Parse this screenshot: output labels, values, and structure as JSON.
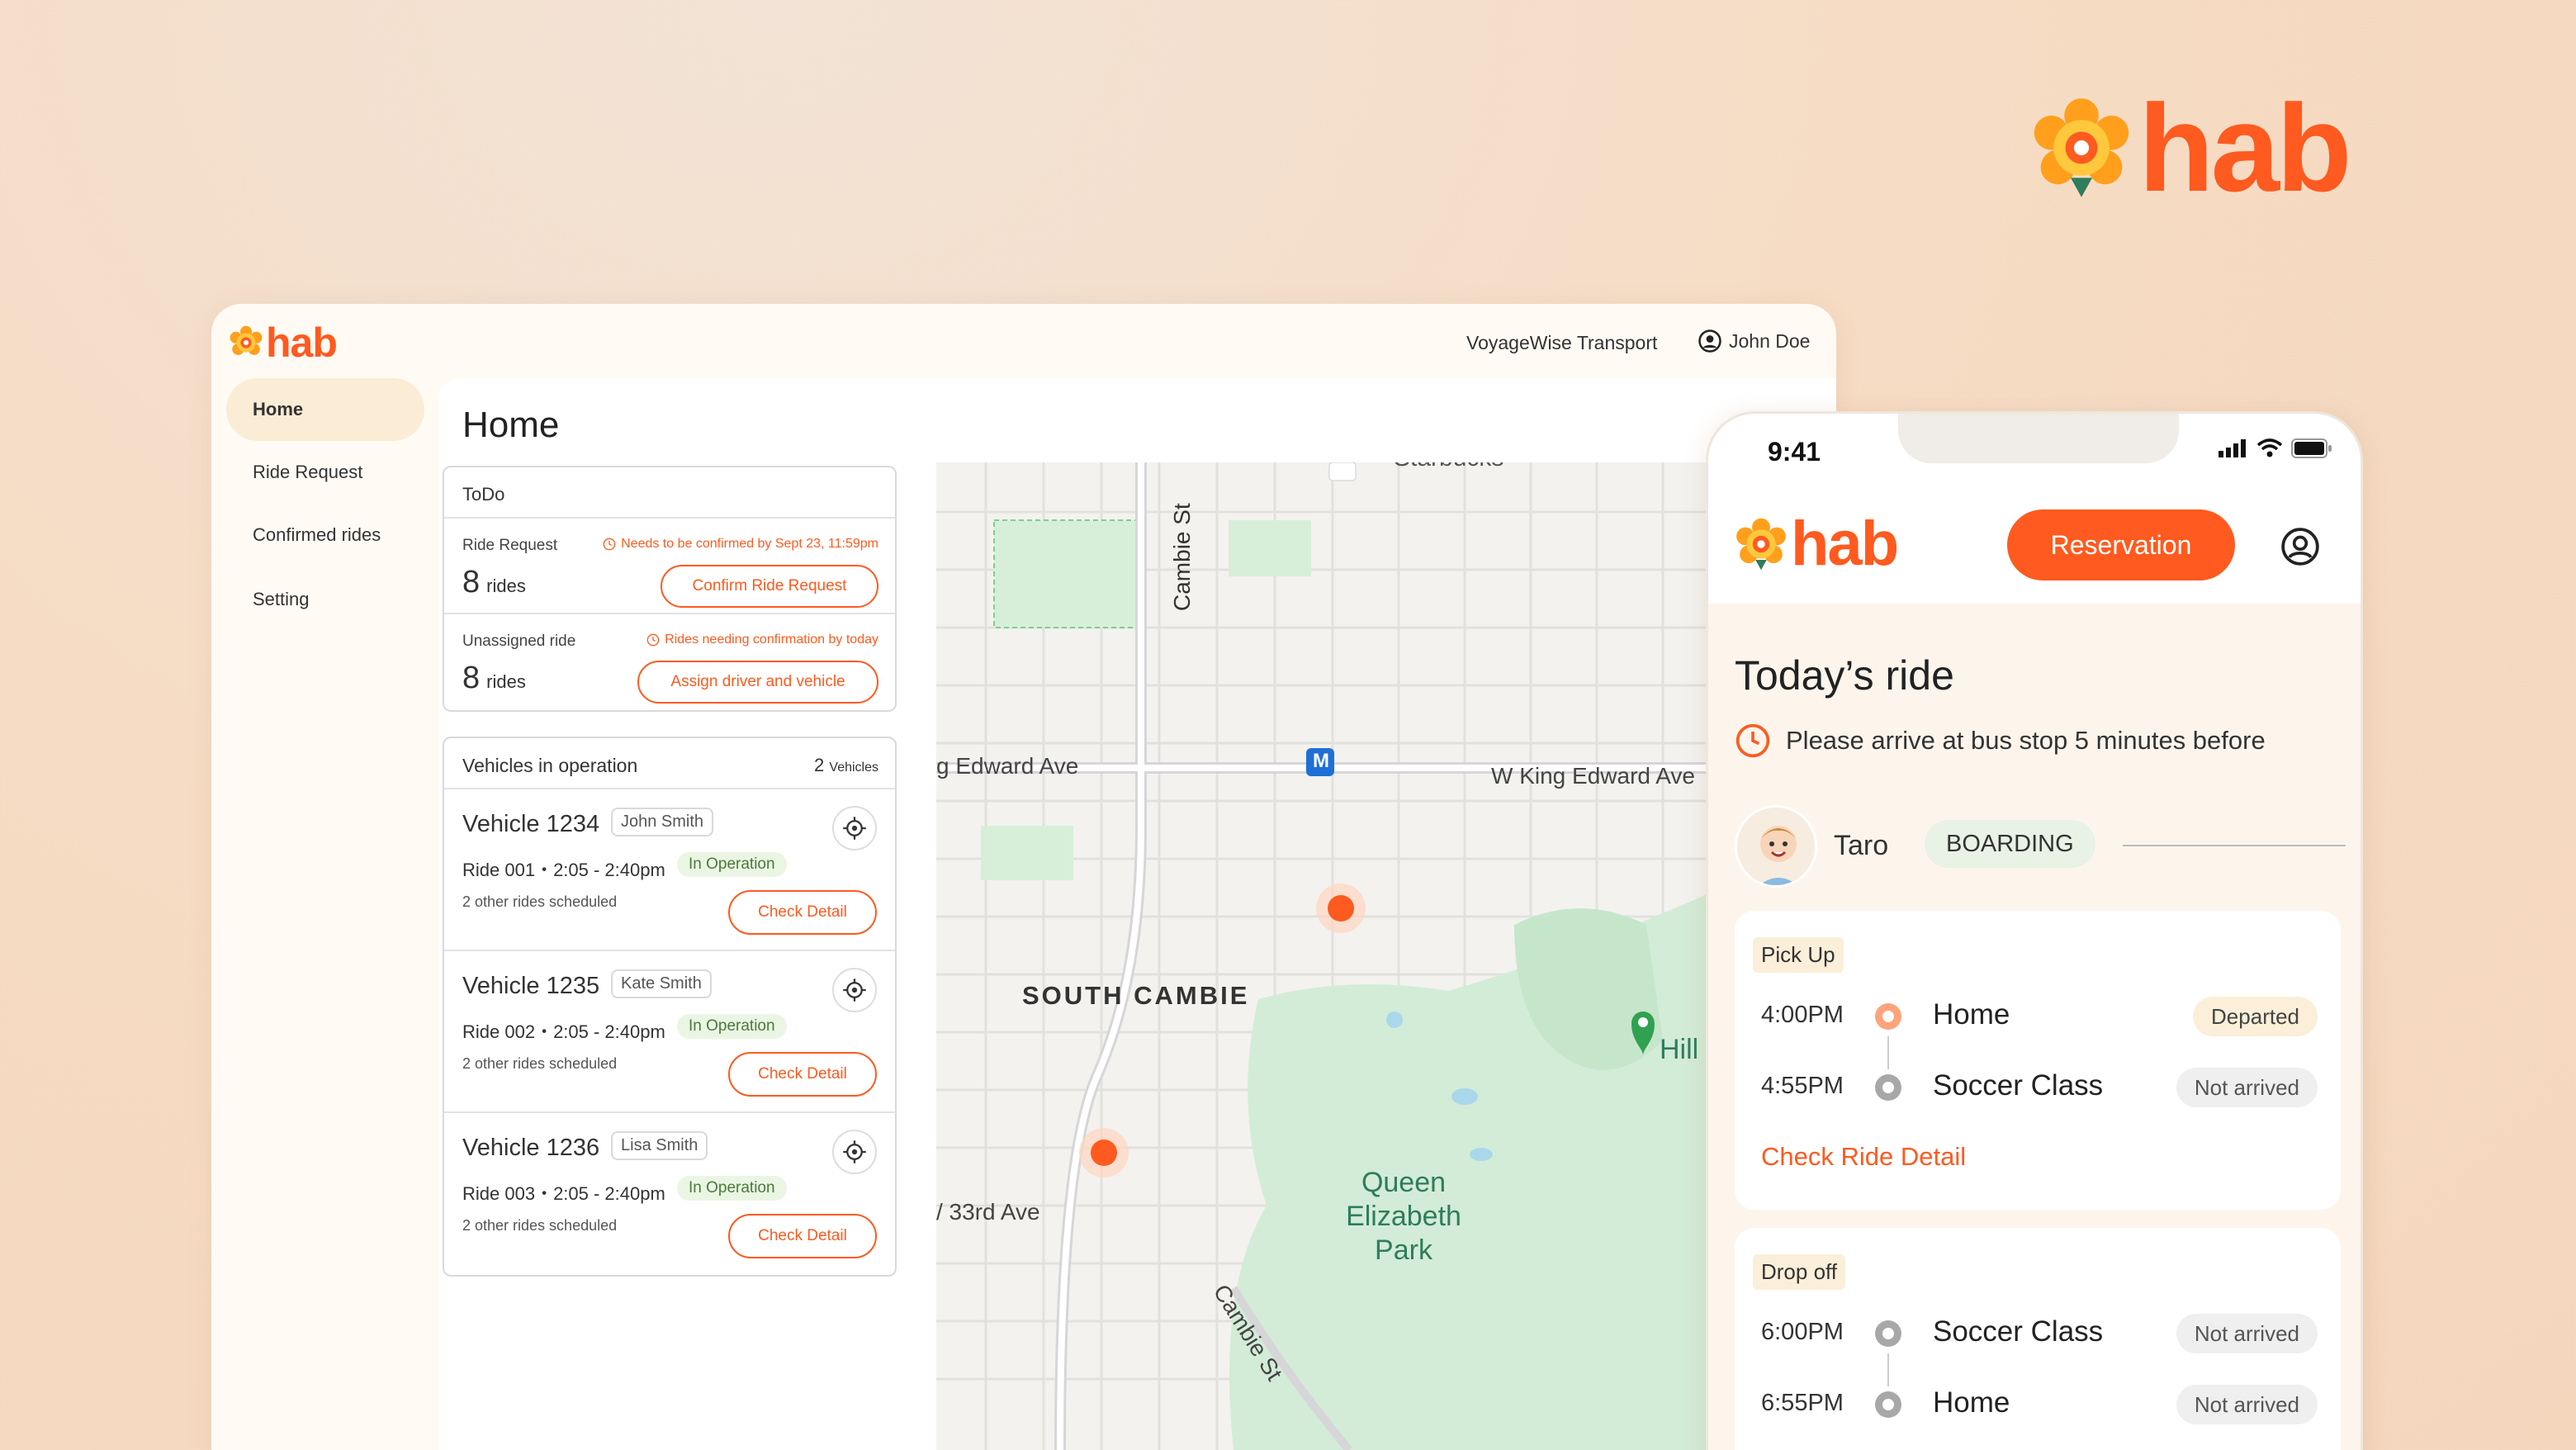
{
  "brand": {
    "name": "hab",
    "color": "#ff5a1f"
  },
  "desktop": {
    "company": "VoyageWise Transport",
    "user": "John Doe",
    "sidebar": [
      {
        "label": "Home",
        "active": true
      },
      {
        "label": "Ride Request",
        "active": false
      },
      {
        "label": "Confirmed rides",
        "active": false
      },
      {
        "label": "Setting",
        "active": false
      }
    ],
    "page_title": "Home",
    "todo": {
      "title": "ToDo",
      "items": [
        {
          "label": "Ride Request",
          "warning": "Needs to be confirmed by Sept 23, 11:59pm",
          "count": "8",
          "unit": "rides",
          "button": "Confirm Ride Request"
        },
        {
          "label": "Unassigned ride",
          "warning": "Rides needing confirmation by today",
          "count": "8",
          "unit": "rides",
          "button": "Assign driver and vehicle"
        }
      ]
    },
    "vehicles": {
      "title": "Vehicles in operation",
      "count": "2",
      "count_unit": "Vehicles",
      "list": [
        {
          "name": "Vehicle 1234",
          "driver": "John Smith",
          "ride": "Ride 001・2:05 - 2:40pm",
          "status": "In Operation",
          "other": "2 other rides scheduled",
          "button": "Check Detail"
        },
        {
          "name": "Vehicle 1235",
          "driver": "Kate Smith",
          "ride": "Ride 002・2:05 - 2:40pm",
          "status": "In Operation",
          "other": "2 other rides scheduled",
          "button": "Check Detail"
        },
        {
          "name": "Vehicle 1236",
          "driver": "Lisa Smith",
          "ride": "Ride 003・2:05 - 2:40pm",
          "status": "In Operation",
          "other": "2 other rides scheduled",
          "button": "Check Detail"
        }
      ]
    },
    "map": {
      "labels": {
        "starbucks": "Starbucks",
        "cambie_st": "Cambie St",
        "edward_left": "g Edward Ave",
        "edward_right": "W King Edward Ave",
        "south_cambie": "SOUTH CAMBIE",
        "park": "Queen Elizabeth Park",
        "hill": "Hill",
        "ave33": "/ 33rd Ave",
        "cambie_st_2": "Cambie St",
        "metro": "M"
      }
    }
  },
  "phone": {
    "time": "9:41",
    "reservation": "Reservation",
    "today_title": "Today’s ride",
    "arrive_note": "Please arrive at bus stop 5 minutes before",
    "passenger": {
      "name": "Taro",
      "status": "BOARDING"
    },
    "pickup": {
      "tag": "Pick Up",
      "stops": [
        {
          "time": "4:00PM",
          "place": "Home",
          "status": "Departed"
        },
        {
          "time": "4:55PM",
          "place": "Soccer Class",
          "status": "Not arrived"
        }
      ],
      "link": "Check Ride Detail"
    },
    "dropoff": {
      "tag": "Drop off",
      "stops": [
        {
          "time": "6:00PM",
          "place": "Soccer Class",
          "status": "Not arrived"
        },
        {
          "time": "6:55PM",
          "place": "Home",
          "status": "Not arrived"
        }
      ]
    }
  }
}
